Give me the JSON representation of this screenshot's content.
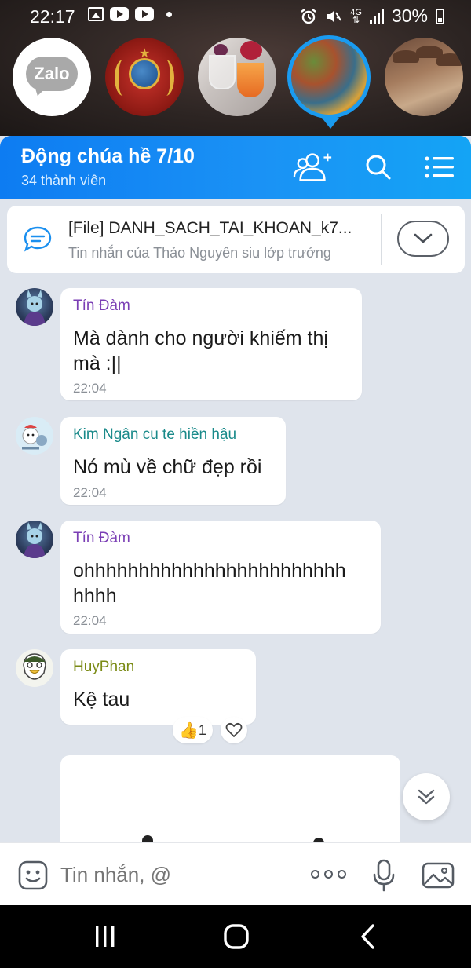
{
  "status_bar": {
    "time": "22:17",
    "network": "4G",
    "battery": "30%",
    "icons": [
      "image-icon",
      "youtube-icon",
      "youtube-icon",
      "dot-icon",
      "alarm-icon",
      "mute-icon",
      "signal-icon",
      "battery-charging-icon"
    ]
  },
  "chat_heads": [
    {
      "name": "zalo-logo",
      "label": "Zalo"
    },
    {
      "name": "chat-head-ussr-emblem"
    },
    {
      "name": "chat-head-drinks"
    },
    {
      "name": "chat-head-current",
      "active": true
    },
    {
      "name": "chat-head-group-photo"
    }
  ],
  "header": {
    "title": "Động chúa hề 7/10",
    "subtitle": "34 thành viên",
    "accent": "#1a92f5"
  },
  "pinned": {
    "title": "[File] DANH_SACH_TAI_KHOAN_k7...",
    "subtitle": "Tin nhắn của Thảo Nguyên siu lớp trưởng"
  },
  "messages": [
    {
      "sender": "Tín Đàm",
      "sender_color": "#7b3fb5",
      "lines": [
        "Mà dành cho người khiếm thị",
        "mà :||"
      ],
      "time": "22:04"
    },
    {
      "sender": "Kim Ngân cu te hiền hậu",
      "sender_color": "#1a8a8a",
      "lines": [
        "Nó mù về chữ đẹp rồi"
      ],
      "time": "22:04"
    },
    {
      "sender": "Tín Đàm",
      "sender_color": "#7b3fb5",
      "lines": [
        "ohhhhhhhhhhhhhhhhhhhhhhhh",
        "hhhh"
      ],
      "time": "22:04"
    },
    {
      "sender": "HuyPhan",
      "sender_color": "#7a8a14",
      "lines": [
        "Kệ tau"
      ],
      "time": ""
    }
  ],
  "reactions": {
    "like_count": "1"
  },
  "input": {
    "placeholder": "Tin nhắn, @"
  }
}
